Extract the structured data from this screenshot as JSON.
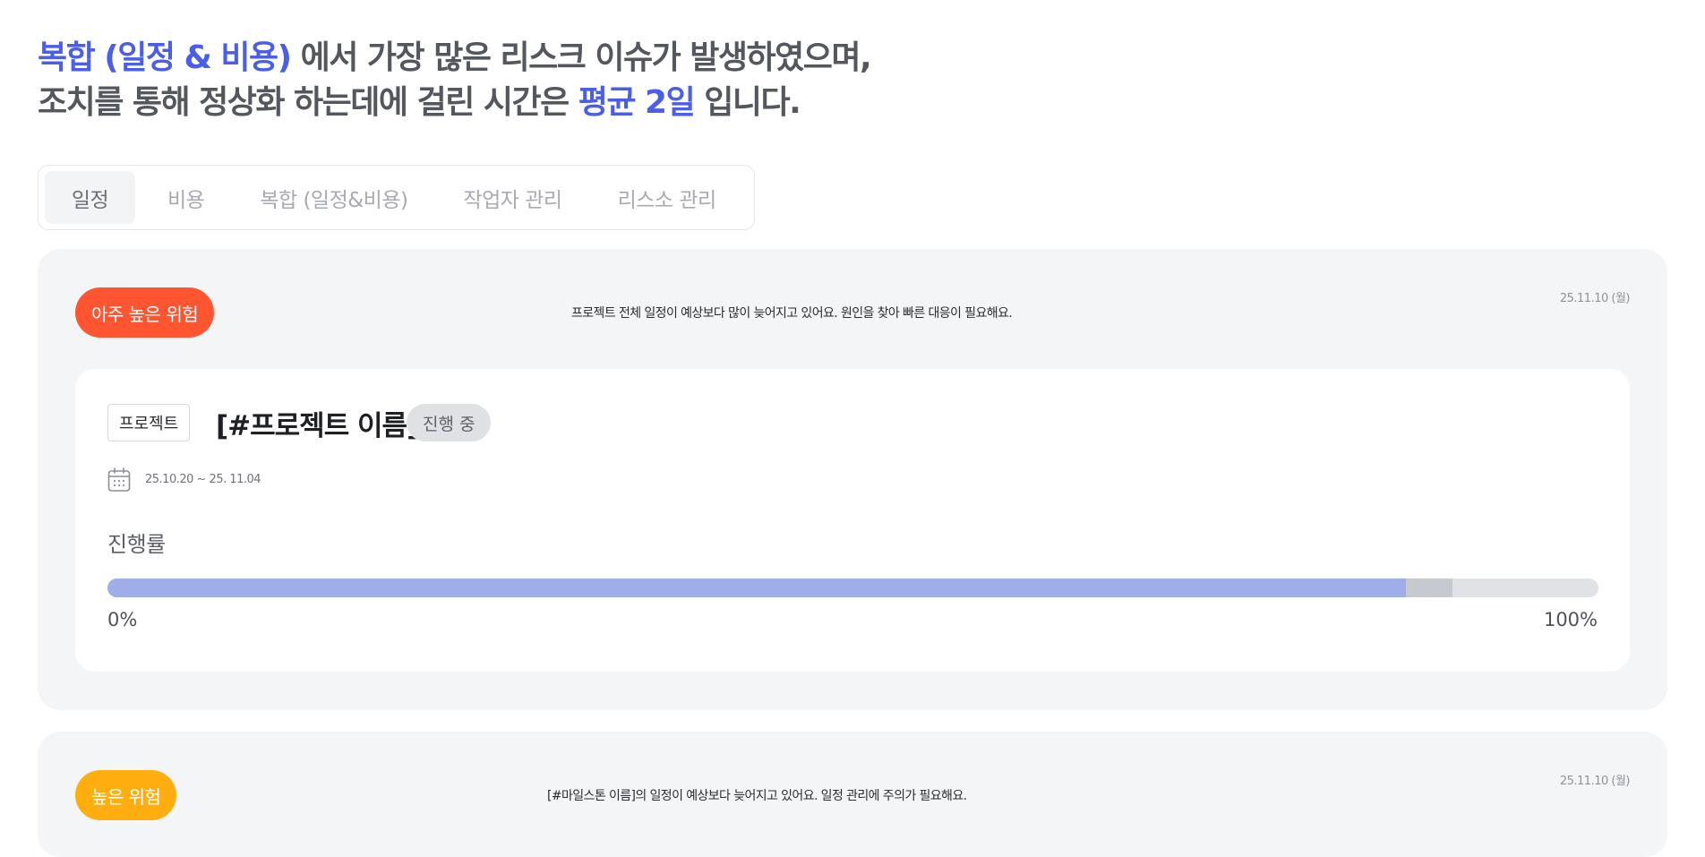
{
  "headline": {
    "line1_highlight": "복합 (일정 & 비용)",
    "line1_rest": " 에서 가장 많은 리스크 이슈가 발생하였으며,",
    "line2_start": "조치를 통해 정상화 하는데에 걸린 시간은 ",
    "line2_highlight": "평균 2일",
    "line2_end": " 입니다."
  },
  "tabs": [
    {
      "label": "일정",
      "active": true
    },
    {
      "label": "비용",
      "active": false
    },
    {
      "label": "복합 (일정&비용)",
      "active": false
    },
    {
      "label": "작업자 관리",
      "active": false
    },
    {
      "label": "리스소 관리",
      "active": false
    }
  ],
  "cards": [
    {
      "risk_label": "아주 높은 위험",
      "risk_color": "#ff5530",
      "message": "프로젝트 전체 일정이 예상보다 많이 늦어지고 있어요. 원인을 찾아 빠른 대응이 필요해요.",
      "date": "25.11.10 (월)",
      "project": {
        "tag": "프로젝트",
        "name": "[#프로젝트 이름]",
        "status": "진행 중",
        "calendar_icon": "calendar-icon",
        "range": "25.10.20 ~ 25. 11.04",
        "progress_label": "진행률",
        "progress_fraction": 0.871,
        "expected_fraction": 0.902,
        "min_label": "0%",
        "max_label": "100%"
      }
    },
    {
      "risk_label": "높은 위험",
      "risk_color": "#ffad0f",
      "message": "[#마일스톤 이름]의 일정이 예상보다 늦어지고 있어요. 일정 관리에 주의가 필요해요.",
      "date": "25.11.10 (월)"
    }
  ]
}
